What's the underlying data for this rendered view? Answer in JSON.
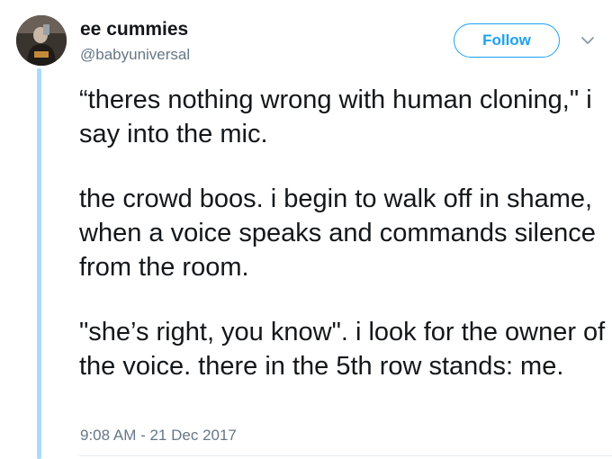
{
  "tweet": {
    "author": {
      "display_name": "ee cummies",
      "handle": "@babyuniversal"
    },
    "follow_label": "Follow",
    "paragraphs": [
      "“theres nothing wrong with human cloning,\" i say into the mic.",
      "the crowd boos. i begin to walk off in shame, when a voice speaks and commands silence from the room.",
      "\"she’s right, you know\". i look for the owner of the voice. there in the 5th row stands: me."
    ],
    "timestamp": "9:08 AM - 21 Dec 2017"
  },
  "colors": {
    "accent": "#1da1f2",
    "thread_line": "#a9dbfb",
    "secondary_text": "#657786",
    "primary_text": "#14171a"
  },
  "icons": {
    "menu": "chevron-down-icon"
  }
}
